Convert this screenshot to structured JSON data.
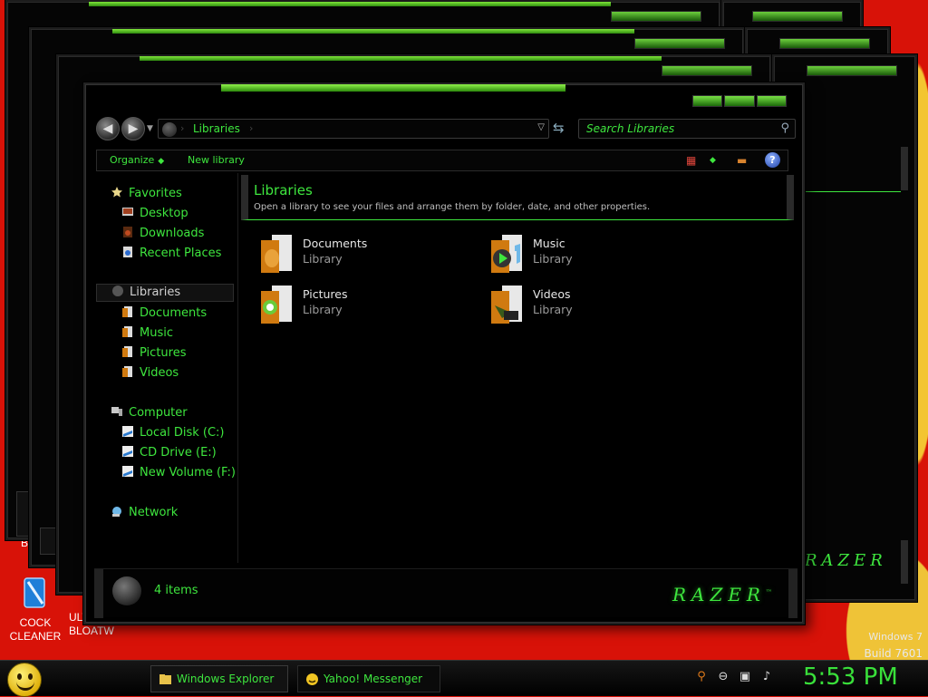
{
  "desktop": {
    "icons": [
      {
        "label_line1": "COCK",
        "label_line2": "CLEANER",
        "icon": "cleaner-icon"
      },
      {
        "label_line1": "ULTRA",
        "label_line2": "BLOATW",
        "icon": "app-icon"
      }
    ],
    "watermark": {
      "line1": "Windows 7",
      "line2": "Build 7601"
    },
    "partial_label": "B"
  },
  "explorer": {
    "address": {
      "crumb": "Libraries"
    },
    "search": {
      "placeholder": "Search Libraries"
    },
    "toolbar": {
      "organize": "Organize",
      "new_library": "New library",
      "help": "?"
    },
    "nav": {
      "favorites": {
        "label": "Favorites",
        "items": [
          "Desktop",
          "Downloads",
          "Recent Places"
        ]
      },
      "libraries": {
        "label": "Libraries",
        "items": [
          "Documents",
          "Music",
          "Pictures",
          "Videos"
        ]
      },
      "computer": {
        "label": "Computer",
        "items": [
          "Local Disk (C:)",
          "CD Drive (E:)",
          "New Volume (F:)"
        ]
      },
      "network": {
        "label": "Network"
      }
    },
    "content": {
      "title": "Libraries",
      "description": "Open a library to see your files and arrange them by folder, date, and other properties.",
      "libraries": [
        {
          "name": "Documents",
          "kind": "Library"
        },
        {
          "name": "Music",
          "kind": "Library"
        },
        {
          "name": "Pictures",
          "kind": "Library"
        },
        {
          "name": "Videos",
          "kind": "Library"
        }
      ]
    },
    "status": {
      "count": "4 items",
      "brand": "RAZER",
      "brand_tm": "™"
    }
  },
  "taskbar": {
    "tasks": [
      {
        "label": "Windows Explorer",
        "active": true
      },
      {
        "label": "Yahoo! Messenger",
        "active": false
      }
    ],
    "clock": "5:53 PM"
  },
  "colors": {
    "accent": "#3ee63e",
    "desktop": "#d81208",
    "window": "#000000"
  }
}
